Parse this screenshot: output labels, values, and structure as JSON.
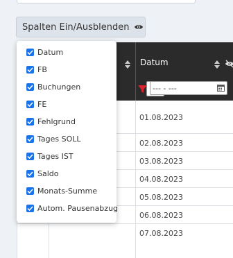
{
  "toolbar": {
    "toggle_columns_label": "Spalten Ein/Ausblenden"
  },
  "table": {
    "header_date_label": "Datum",
    "date_filter_value": "--- - ---",
    "rows": [
      "01.08.2023",
      "02.08.2023",
      "03.08.2023",
      "04.08.2023",
      "05.08.2023",
      "06.08.2023",
      "07.08.2023"
    ]
  },
  "column_menu": {
    "items": [
      {
        "label": "Datum",
        "checked": true
      },
      {
        "label": "FB",
        "checked": true
      },
      {
        "label": "Buchungen",
        "checked": true
      },
      {
        "label": "FE",
        "checked": true
      },
      {
        "label": "Fehlgrund",
        "checked": true
      },
      {
        "label": "Tages SOLL",
        "checked": true
      },
      {
        "label": "Tages IST",
        "checked": true
      },
      {
        "label": "Saldo",
        "checked": true
      },
      {
        "label": "Monats-Summe",
        "checked": true
      },
      {
        "label": "Autom. Pausenabzug",
        "checked": true
      }
    ]
  },
  "colors": {
    "checkbox": "#1a73e8",
    "header_bg": "#2b2b2b",
    "filter_icon": "#d9232e"
  }
}
